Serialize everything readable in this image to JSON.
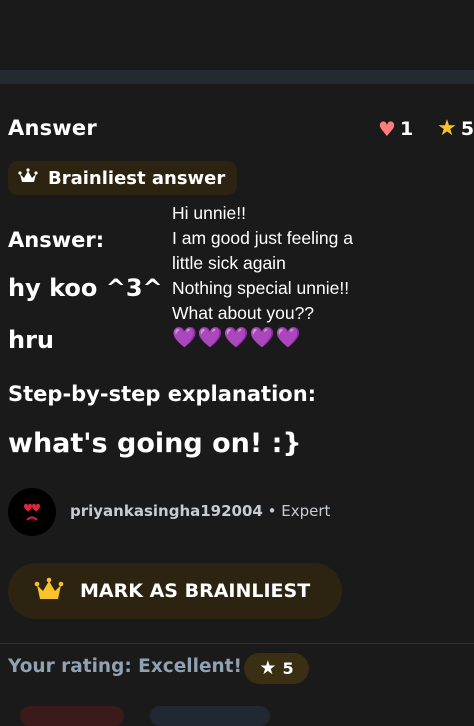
{
  "header": {
    "title": "Answer"
  },
  "stats": {
    "heart_icon": "heart-icon",
    "likes": "1",
    "star_icon": "star-icon",
    "stars": "5"
  },
  "badge": {
    "icon": "crown-icon",
    "label": "Brainliest answer"
  },
  "answer_body": {
    "answer_label": "Answer:",
    "line1": "hy koo ^3^",
    "line2": "hru",
    "step_label": "Step-by-step explanation:",
    "step_text": "what's going on! :}"
  },
  "overlay_reply": {
    "line1": "Hi unnie!!",
    "line2": "I am good just feeling a",
    "line3": "little sick again",
    "line4": "Nothing special unnie!!",
    "line5": "What about you??",
    "hearts": "💜💜💜💜💜"
  },
  "author": {
    "avatar_icon": "crying-heart-eyes-avatar",
    "username": "priyankasingha192004",
    "separator": " • ",
    "rank": "Expert"
  },
  "mark_button": {
    "icon": "crown-icon",
    "label": "MARK AS BRAINLIEST"
  },
  "rating": {
    "label": "Your rating: Excellent!",
    "star_icon": "star-icon",
    "value": "5"
  },
  "colors": {
    "accent_gold": "#f8c22b",
    "heart": "#ff7c7c",
    "badge_bg": "#2c2410",
    "rating_text": "#8fa1b3"
  }
}
